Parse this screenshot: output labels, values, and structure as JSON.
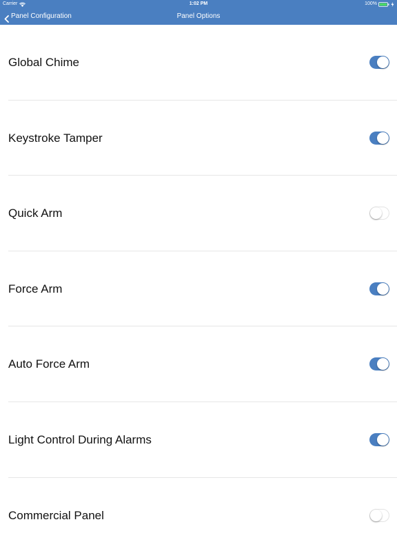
{
  "status_bar": {
    "carrier": "Carrier",
    "time": "1:02 PM",
    "battery": "100%"
  },
  "nav": {
    "back_label": "Panel Configuration",
    "title": "Panel Options"
  },
  "colors": {
    "accent": "#4a7fc1",
    "separator": "#e6e6e6"
  },
  "options": [
    {
      "label": "Global Chime",
      "enabled": true
    },
    {
      "label": "Keystroke Tamper",
      "enabled": true
    },
    {
      "label": "Quick Arm",
      "enabled": false
    },
    {
      "label": "Force Arm",
      "enabled": true
    },
    {
      "label": "Auto Force Arm",
      "enabled": true
    },
    {
      "label": "Light Control During Alarms",
      "enabled": true
    },
    {
      "label": "Commercial Panel",
      "enabled": false
    }
  ]
}
